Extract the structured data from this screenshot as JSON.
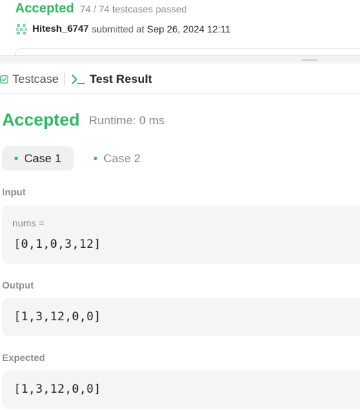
{
  "submission": {
    "status": "Accepted",
    "cases_passed": "74 / 74 testcases passed",
    "username": "Hitesh_6747",
    "submitted_at_prefix": "submitted at",
    "submitted_at": "Sep 26, 2024 12:11"
  },
  "tabs": {
    "testcase_label": "Testcase",
    "test_result_label": "Test Result",
    "active": "test_result"
  },
  "result": {
    "status": "Accepted",
    "runtime": "Runtime: 0 ms"
  },
  "cases": [
    {
      "label": "Case 1",
      "selected": true
    },
    {
      "label": "Case 2",
      "selected": false
    }
  ],
  "input": {
    "section_label": "Input",
    "var_label": "nums =",
    "value": "[0,1,0,3,12]"
  },
  "output": {
    "section_label": "Output",
    "value": "[1,3,12,0,0]"
  },
  "expected": {
    "section_label": "Expected",
    "value": "[1,3,12,0,0]"
  },
  "colors": {
    "accepted_green": "#2cbb5d",
    "muted_text": "#8c8c8c",
    "box_background": "#f5f5f5"
  },
  "icons": {
    "testcase": "checkbox-icon",
    "test_result": "terminal-icon",
    "avatar": "user-avatar-icon"
  }
}
